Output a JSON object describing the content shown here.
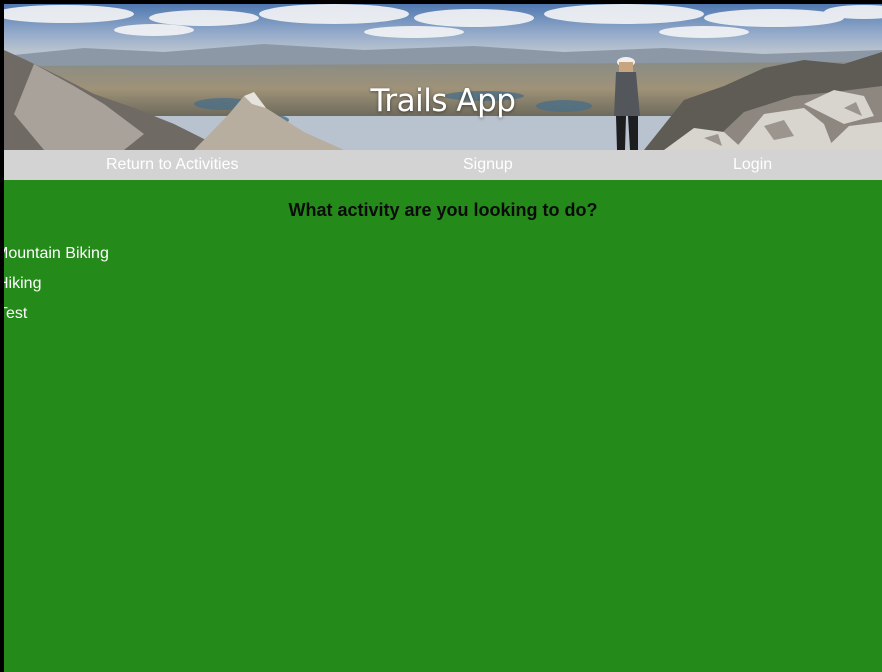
{
  "header": {
    "title": "Trails App"
  },
  "nav": {
    "return_label": "Return to Activities",
    "signup_label": "Signup",
    "login_label": "Login"
  },
  "main": {
    "question": "What activity are you looking to do?",
    "activities": [
      {
        "label": "Mountain Biking"
      },
      {
        "label": "Hiking"
      },
      {
        "label": "Test"
      }
    ]
  },
  "colors": {
    "page_background": "#248a19",
    "nav_background": "#d3d3d3",
    "nav_text": "#ffffff",
    "question_text": "#0b0b0b",
    "activity_text": "#ffffff"
  }
}
